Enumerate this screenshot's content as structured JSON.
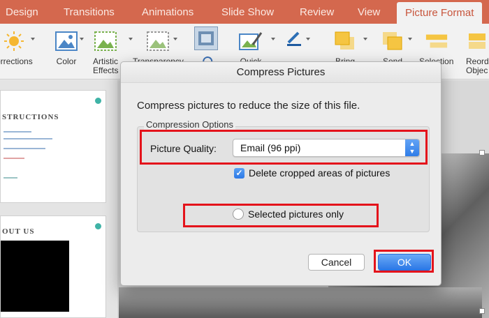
{
  "ribbon_tabs": [
    "Design",
    "Transitions",
    "Animations",
    "Slide Show",
    "Review",
    "View",
    "Picture Format"
  ],
  "ribbon_buttons": {
    "corrections": "orrections",
    "color": "Color",
    "artistic": "Artistic\nEffects",
    "transparency": "Transparency",
    "quick": "Quick",
    "bring": "Bring",
    "send": "Send",
    "selection": "Selection",
    "reorder": "Reord\nObjec"
  },
  "slides": [
    {
      "title": "STRUCTIONS"
    },
    {
      "title": "OUT US"
    }
  ],
  "dialog": {
    "title": "Compress Pictures",
    "description": "Compress pictures to reduce the size of this file.",
    "group_label": "Compression Options",
    "quality_label": "Picture Quality:",
    "quality_value": "Email (96 ppi)",
    "delete_cropped_label": "Delete cropped areas of pictures",
    "delete_cropped_checked": true,
    "selected_only_label": "Selected pictures only",
    "selected_only_checked": false,
    "cancel_label": "Cancel",
    "ok_label": "OK"
  },
  "colors": {
    "ribbon_accent": "#d4684e",
    "annotation_red": "#e4131b",
    "primary_blue": "#2b77e6"
  }
}
